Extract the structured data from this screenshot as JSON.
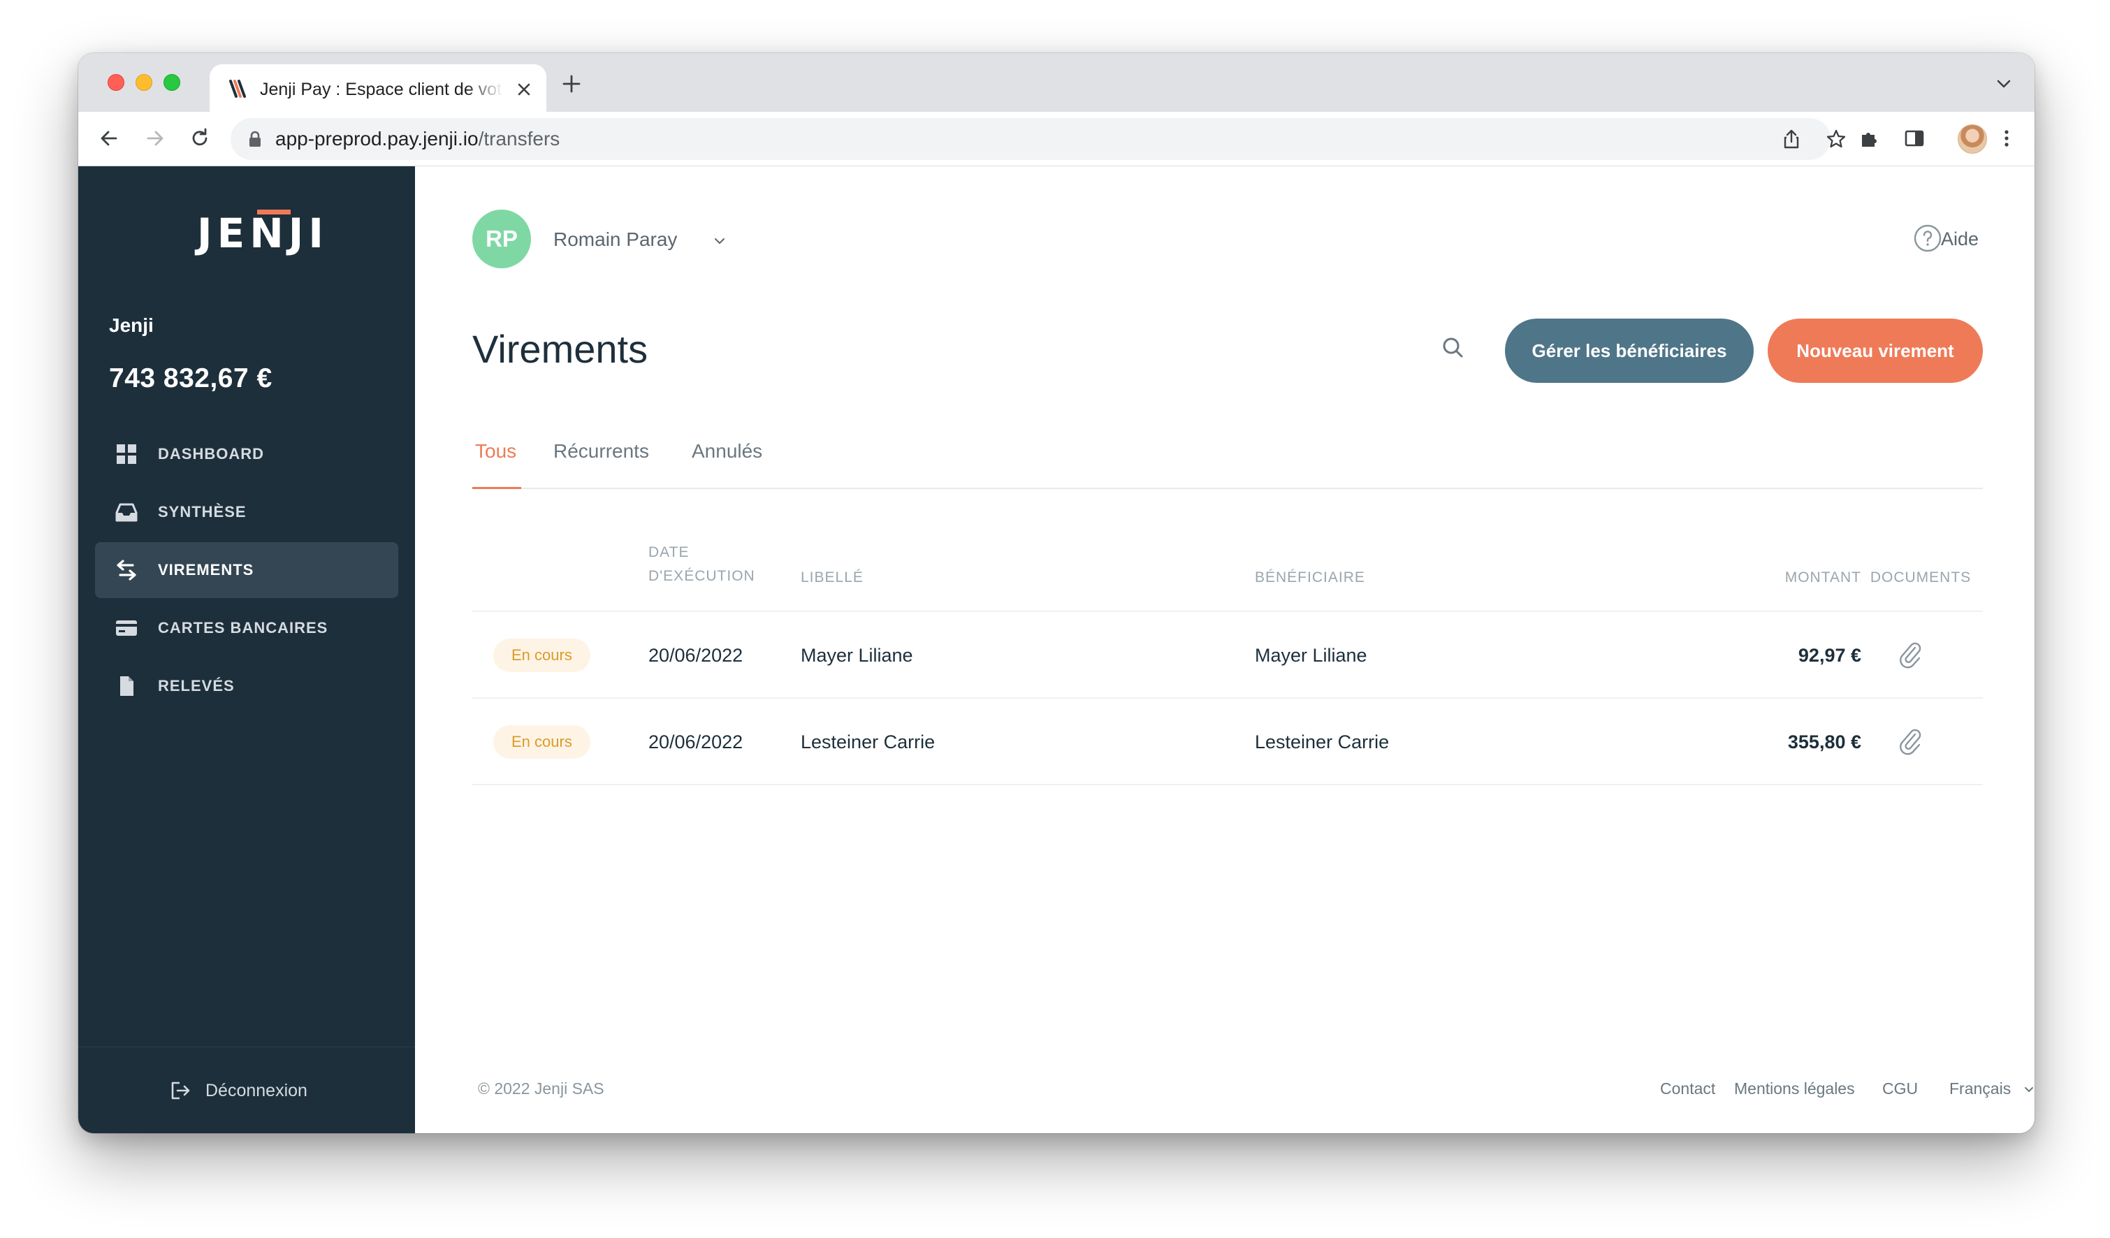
{
  "browser": {
    "tab_title": "Jenji Pay : Espace client de votre compte",
    "url_host": "app-preprod.pay.jenji.io",
    "url_path": "/transfers"
  },
  "sidebar": {
    "logo": "JENJI",
    "account_name": "Jenji",
    "balance": "743 832,67 €",
    "items": [
      {
        "label": "DASHBOARD",
        "icon": "dashboard-grid-icon"
      },
      {
        "label": "SYNTHÈSE",
        "icon": "inbox-tray-icon"
      },
      {
        "label": "VIREMENTS",
        "icon": "transfer-arrows-icon",
        "active": true
      },
      {
        "label": "CARTES BANCAIRES",
        "icon": "credit-card-icon"
      },
      {
        "label": "RELEVÉS",
        "icon": "document-icon"
      }
    ],
    "logout_label": "Déconnexion"
  },
  "header": {
    "avatar_initials": "RP",
    "user_name": "Romain Paray",
    "help_label": "Aide"
  },
  "page": {
    "title": "Virements",
    "manage_beneficiaries_label": "Gérer les bénéficiaires",
    "new_transfer_label": "Nouveau virement"
  },
  "tabs": [
    {
      "label": "Tous",
      "active": true
    },
    {
      "label": "Récurrents"
    },
    {
      "label": "Annulés"
    }
  ],
  "table": {
    "columns": {
      "date_line1": "DATE",
      "date_line2": "D'EXÉCUTION",
      "label": "LIBELLÉ",
      "beneficiary": "BÉNÉFICIAIRE",
      "amount": "MONTANT",
      "documents": "DOCUMENTS"
    },
    "rows": [
      {
        "status": "En cours",
        "date": "20/06/2022",
        "label": "Mayer Liliane",
        "beneficiary": "Mayer Liliane",
        "amount": "92,97 €"
      },
      {
        "status": "En cours",
        "date": "20/06/2022",
        "label": "Lesteiner Carrie",
        "beneficiary": "Lesteiner Carrie",
        "amount": "355,80 €"
      }
    ]
  },
  "footer": {
    "copyright": "© 2022 Jenji SAS",
    "links": [
      "Contact",
      "Mentions légales",
      "CGU"
    ],
    "language": "Français"
  },
  "colors": {
    "sidebar_bg": "#1d2f3b",
    "accent": "#ef7a57",
    "secondary_button": "#4f7588",
    "avatar_bg": "#7fd8a4",
    "status_badge_bg": "#fdf4e6",
    "status_badge_text": "#dd9a28"
  }
}
